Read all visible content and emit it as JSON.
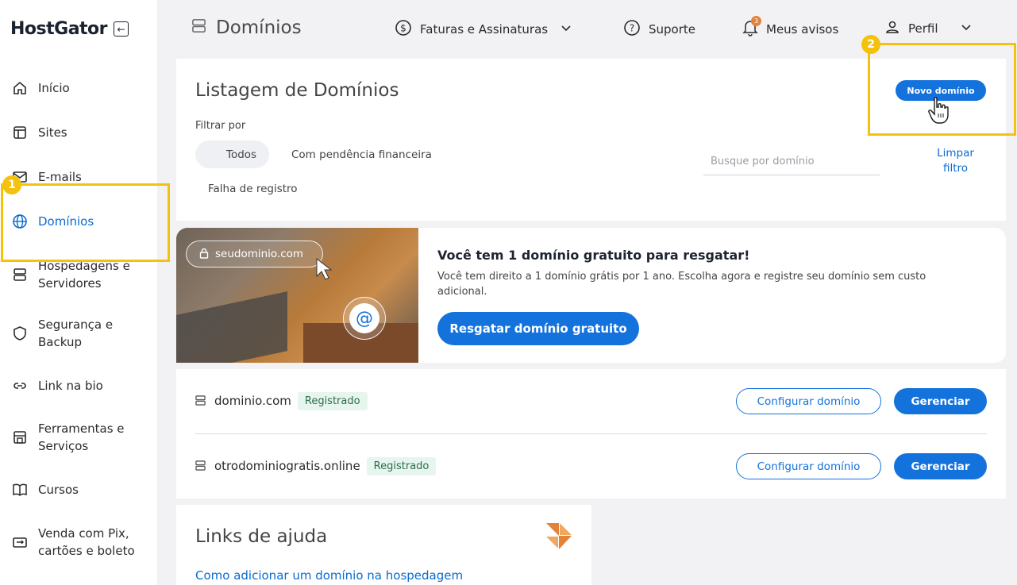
{
  "brand": {
    "logo": "HostGator"
  },
  "sidebar": {
    "items": [
      {
        "label": "Início",
        "icon": "home-icon"
      },
      {
        "label": "Sites",
        "icon": "layout-icon"
      },
      {
        "label": "E-mails",
        "icon": "mail-icon"
      },
      {
        "label": "Domínios",
        "icon": "globe-icon",
        "active": true
      },
      {
        "label": "Hospedagens e Servidores",
        "icon": "server-icon"
      },
      {
        "label": "Segurança e Backup",
        "icon": "shield-icon"
      },
      {
        "label": "Link na bio",
        "icon": "link-icon"
      },
      {
        "label": "Ferramentas e Serviços",
        "icon": "store-icon"
      },
      {
        "label": "Cursos",
        "icon": "book-icon"
      },
      {
        "label": "Venda com Pix, cartões e boleto",
        "icon": "payment-icon"
      }
    ]
  },
  "header": {
    "title": "Domínios",
    "billing": "Faturas e Assinaturas",
    "support": "Suporte",
    "notices": "Meus avisos",
    "notices_count": "3",
    "profile": "Perfil"
  },
  "steps": {
    "one": "1",
    "two": "2"
  },
  "listing": {
    "title": "Listagem de Domínios",
    "filter_label": "Filtrar por",
    "filters": [
      "Todos",
      "Com pendência financeira",
      "Falha de registro"
    ],
    "search_placeholder": "Busque por domínio",
    "clear_filter": "Limpar filtro",
    "new_domain": "Novo domínio"
  },
  "promo": {
    "image_domain": "seudominio.com",
    "image_at": "@",
    "title": "Você tem 1 domínio gratuito para resgatar!",
    "text": "Você tem direito a 1 domínio grátis por 1 ano. Escolha agora e registre seu domínio sem custo adicional.",
    "button": "Resgatar domínio gratuito"
  },
  "domains": [
    {
      "name": "dominio.com",
      "status": "Registrado",
      "configure": "Configurar domínio",
      "manage": "Gerenciar"
    },
    {
      "name": "otrodominiogratis.online",
      "status": "Registrado",
      "configure": "Configurar domínio",
      "manage": "Gerenciar"
    }
  ],
  "help": {
    "title": "Links de ajuda",
    "link": "Como adicionar um domínio na hospedagem"
  },
  "colors": {
    "accent": "#1472dc",
    "highlight": "#f4c20d",
    "brand_orange": "#e3833a"
  }
}
